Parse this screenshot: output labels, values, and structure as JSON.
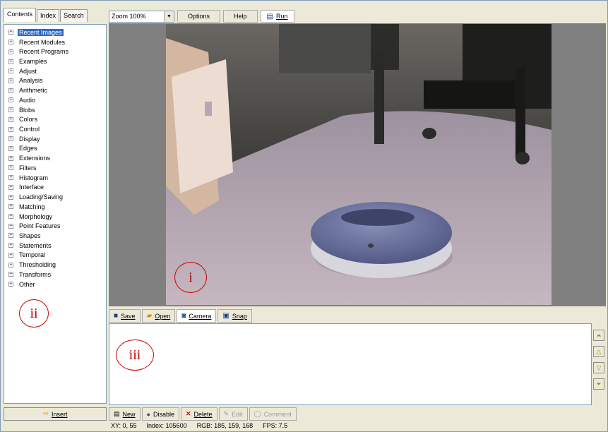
{
  "left_panel": {
    "tabs": [
      "Contents",
      "Index",
      "Search"
    ],
    "tree_items": [
      {
        "label": "Recent Images",
        "selected": true
      },
      {
        "label": "Recent Modules"
      },
      {
        "label": "Recent Programs"
      },
      {
        "label": "Examples"
      },
      {
        "label": "Adjust"
      },
      {
        "label": "Analysis"
      },
      {
        "label": "Arithmetic"
      },
      {
        "label": "Audio"
      },
      {
        "label": "Blobs"
      },
      {
        "label": "Colors"
      },
      {
        "label": "Control"
      },
      {
        "label": "Display"
      },
      {
        "label": "Edges"
      },
      {
        "label": "Extensions"
      },
      {
        "label": "Filters"
      },
      {
        "label": "Histogram"
      },
      {
        "label": "Interface"
      },
      {
        "label": "Loading/Saving"
      },
      {
        "label": "Matching"
      },
      {
        "label": "Morphology"
      },
      {
        "label": "Point Features"
      },
      {
        "label": "Shapes"
      },
      {
        "label": "Statements"
      },
      {
        "label": "Temporal"
      },
      {
        "label": "Thresholding"
      },
      {
        "label": "Transforms"
      },
      {
        "label": "Other"
      }
    ],
    "insert_label": "Insert"
  },
  "toolbar": {
    "zoom_value": "Zoom 100%",
    "options_label": "Options",
    "help_label": "Help",
    "run_label": "Run"
  },
  "image_toolbar": {
    "save_label": "Save",
    "open_label": "Open",
    "camera_label": "Camera",
    "snap_label": "Snap"
  },
  "action_bar": {
    "new_label": "New",
    "disable_label": "Disable",
    "delete_label": "Delete",
    "edit_label": "Edit",
    "comment_label": "Comment"
  },
  "status": {
    "xy": "XY: 0, 55",
    "index": "Index: 105600",
    "rgb": "RGB: 185, 159, 168",
    "fps": "FPS: 7.5"
  },
  "annotations": {
    "i": "i",
    "ii": "ii",
    "iii": "iii"
  },
  "colors": {
    "window_bg": "#ece9d8",
    "selection": "#316ac5",
    "annotation_red": "#d40000"
  }
}
